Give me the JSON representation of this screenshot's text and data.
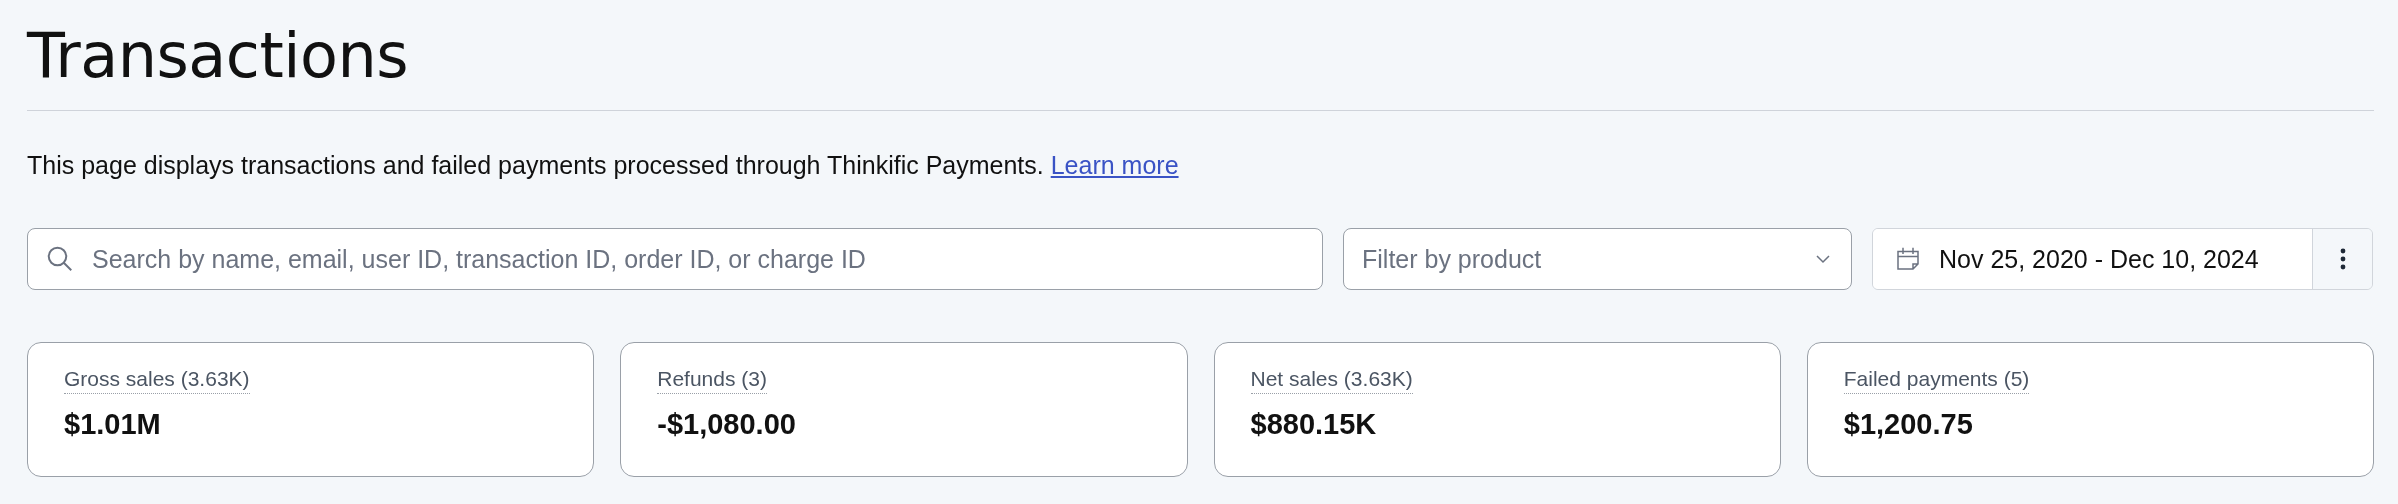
{
  "page": {
    "title": "Transactions",
    "description": "This page displays transactions and failed payments processed through Thinkific Payments.",
    "learn_more_link": "Learn more"
  },
  "filters": {
    "search": {
      "placeholder": "Search by name, email, user ID, transaction ID, order ID, or charge ID"
    },
    "product": {
      "placeholder": "Filter by product"
    },
    "date_range": "Nov 25, 2020 - Dec 10, 2024"
  },
  "stats": [
    {
      "label": "Gross sales (3.63K)",
      "value": "$1.01M"
    },
    {
      "label": "Refunds (3)",
      "value": "-$1,080.00"
    },
    {
      "label": "Net sales (3.63K)",
      "value": "$880.15K"
    },
    {
      "label": "Failed payments (5)",
      "value": "$1,200.75"
    }
  ]
}
